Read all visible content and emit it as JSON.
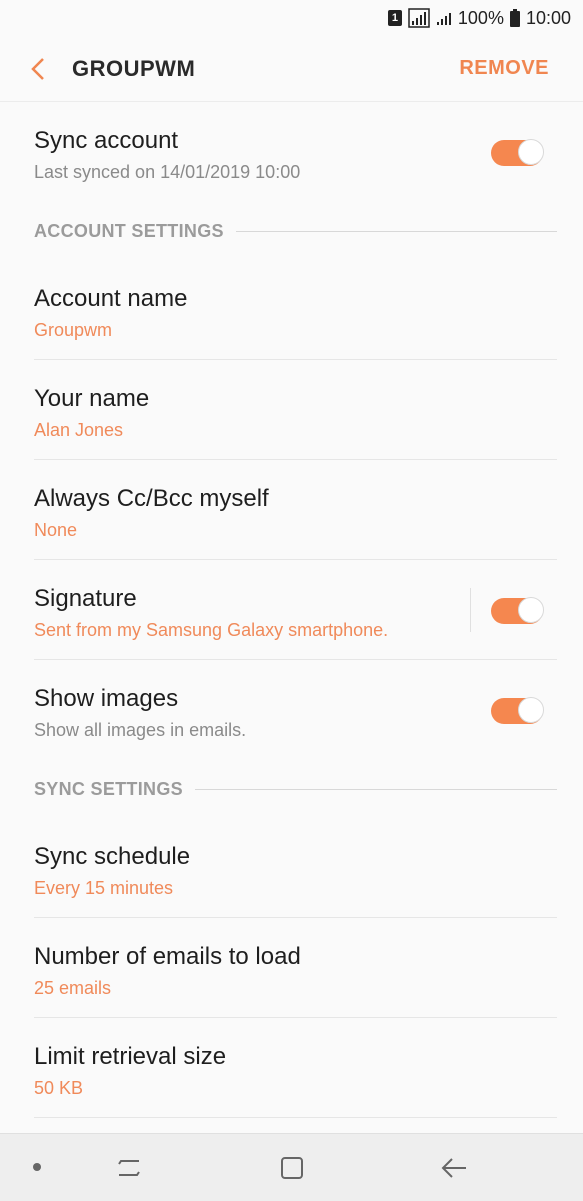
{
  "status_bar": {
    "sim_slot": "1",
    "battery": "100%",
    "time": "10:00",
    "icons": [
      "sim-icon",
      "signal-icon",
      "signal-weak-icon",
      "battery-icon"
    ]
  },
  "app_bar": {
    "title": "GROUPWM",
    "remove_label": "REMOVE",
    "accent": "#f08650"
  },
  "sync_account": {
    "title": "Sync account",
    "subtitle": "Last synced on 14/01/2019  10:00",
    "enabled": true
  },
  "account_settings": {
    "header": "ACCOUNT SETTINGS",
    "items": [
      {
        "title": "Account name",
        "value": "Groupwm"
      },
      {
        "title": "Your name",
        "value": "Alan Jones"
      },
      {
        "title": "Always Cc/Bcc myself",
        "value": "None"
      },
      {
        "title": "Signature",
        "value": "Sent from my Samsung Galaxy smartphone.",
        "enabled": true
      },
      {
        "title": "Show images",
        "value": "Show all images in emails.",
        "enabled": true
      }
    ]
  },
  "sync_settings": {
    "header": "SYNC SETTINGS",
    "items": [
      {
        "title": "Sync schedule",
        "value": "Every 15 minutes"
      },
      {
        "title": "Number of emails to load",
        "value": "25 emails"
      },
      {
        "title": "Limit retrieval size",
        "value": "50 KB"
      }
    ]
  },
  "nav_bar": {
    "icons": [
      "nav-dot-icon",
      "recents-icon",
      "home-icon",
      "back-icon"
    ]
  },
  "colors": {
    "toggle_on": "#f5874f",
    "value_text": "#f08a5a"
  }
}
